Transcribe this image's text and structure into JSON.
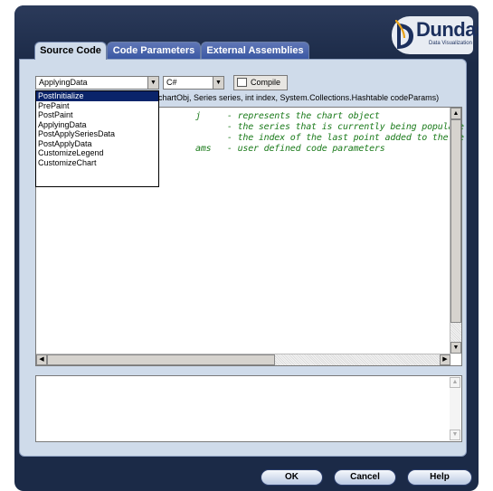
{
  "logo": {
    "word": "Dundas",
    "tagline": "Data Visualization"
  },
  "tabs": [
    {
      "label": "Source Code",
      "active": true
    },
    {
      "label": "Code Parameters",
      "active": false
    },
    {
      "label": "External Assemblies",
      "active": false
    }
  ],
  "event_combo": {
    "value": "ApplyingData"
  },
  "language_combo": {
    "value": "C#"
  },
  "compile_button": {
    "label": "Compile"
  },
  "signature": "chartObj, Series series, int index, System.Collections.Hashtable codeParams)",
  "event_dropdown": {
    "items": [
      "PostInitialize",
      "PrePaint",
      "PostPaint",
      "ApplyingData",
      "PostApplySeriesData",
      "PostApplyData",
      "CustomizeLegend",
      "CustomizeChart"
    ],
    "highlighted": "PostInitialize"
  },
  "code_lines": [
    "j     - represents the chart object",
    "      - the series that is currently being populate",
    "      - the index of the last point added to the se",
    "ams   - user defined code parameters"
  ],
  "footer_buttons": {
    "ok": "OK",
    "cancel": "Cancel",
    "help": "Help"
  },
  "colors": {
    "frame": "#1b2a47",
    "panel": "#cfdbea",
    "tab_inactive": "#3a58a4",
    "selection": "#0a246a",
    "code_comment": "#1a7a1a"
  }
}
